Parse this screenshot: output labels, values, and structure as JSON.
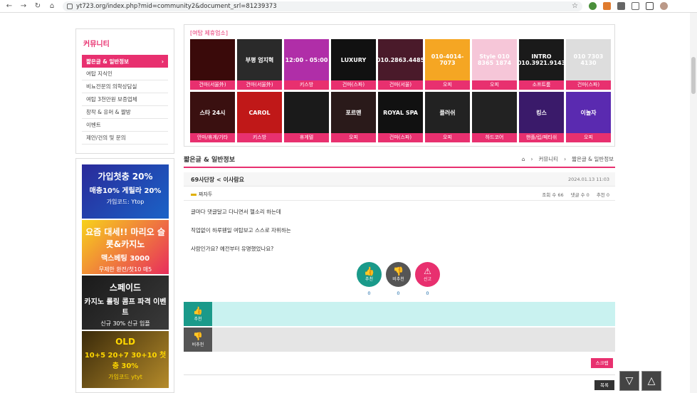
{
  "browser": {
    "url": "yt723.org/index.php?mid=community2&document_srl=81239373"
  },
  "sidebar": {
    "title": "커뮤니티",
    "items": [
      {
        "label": "짧은글 & 일반정보"
      },
      {
        "label": "여탑 지식인"
      },
      {
        "label": "비뇨전문의 의학상담실"
      },
      {
        "label": "여탑 3천만원 보증업체"
      },
      {
        "label": "창작 & 유머 & 짤방"
      },
      {
        "label": "이벤트"
      },
      {
        "label": "제안/건의 및 문의"
      }
    ]
  },
  "banners": [
    {
      "l1": "가입첫충 20%",
      "l2": "매충10% 게릴라 20%",
      "l3": "가입코드: Ytop"
    },
    {
      "l1": "요즘 대세!! 마리오 슬롯&카지노",
      "l2": "맥스베팅 3000",
      "l3": "무제한 환전/첫10 매5"
    },
    {
      "l1": "스페이드",
      "l2": "카지노 롤링 콤프 파격 이벤트",
      "l3": "신규 30%  신규 입플"
    },
    {
      "l1": "OLD",
      "l2": "10+5 20+7 30+10 첫충 30%",
      "l3": "가입코드 ytyt"
    }
  ],
  "affiliates": {
    "title": "[여탑 제휴업소]",
    "tiles": [
      {
        "text": "",
        "cap": "건마(서울外)",
        "color": "#3a0a0a"
      },
      {
        "text": "부평 엄지혁",
        "cap": "건마(서울外)",
        "color": "#2a2a2a"
      },
      {
        "text": "12:00 - 05:00",
        "cap": "키스방",
        "color": "#b02ea8"
      },
      {
        "text": "LUXURY",
        "cap": "건마(스파)",
        "color": "#111"
      },
      {
        "text": "010.2863.4485",
        "cap": "건마(서울)",
        "color": "#4a1a2a"
      },
      {
        "text": "010-4014-7073",
        "cap": "오피",
        "color": "#f5a623"
      },
      {
        "text": "Style 010 8365 1874",
        "cap": "오피",
        "color": "#f6c6d8"
      },
      {
        "text": "INTRO 010.3921.9143",
        "cap": "소프트룸",
        "color": "#1a1a1a"
      },
      {
        "text": "010 7303 4130",
        "cap": "건마(스파)",
        "color": "#ddd"
      },
      {
        "text": "스타 24시",
        "cap": "안마/휴게/기타",
        "color": "#3a1010"
      },
      {
        "text": "CAROL",
        "cap": "키스방",
        "color": "#c01818"
      },
      {
        "text": "",
        "cap": "휴게텔",
        "color": "#1a1a1a"
      },
      {
        "text": "포르맨",
        "cap": "오피",
        "color": "#2a1a1a"
      },
      {
        "text": "ROYAL SPA",
        "cap": "건마(스파)",
        "color": "#111"
      },
      {
        "text": "플러쉬",
        "cap": "오피",
        "color": "#222"
      },
      {
        "text": "",
        "cap": "하드코어",
        "color": "#222"
      },
      {
        "text": "킹스",
        "cap": "핸플/립/페티쉬",
        "color": "#3a1a6a"
      },
      {
        "text": "이놀자",
        "cap": "오피",
        "color": "#5a2ab0"
      }
    ]
  },
  "board": {
    "title": "짧은글 & 일반정보",
    "breadcrumb": [
      "커뮤니티",
      "짧은글 & 일반정보"
    ]
  },
  "post": {
    "title": "69사단장 < 이사람요",
    "date": "2024.01.13 11:03",
    "author": "짜자두",
    "views": "조회 수 66",
    "comments": "댓글 수 0",
    "recommends": "추천 0",
    "lines": [
      "글마다 댓글달고 다니면서 헬소리 하는데",
      "직업없이 하루웬일 여탑보고 스스로 자위하는",
      "사람인가요? 예전부터 유명했었나요?"
    ]
  },
  "votes": {
    "up_label": "추천",
    "down_label": "비추천",
    "report_label": "신고",
    "up_count": "0",
    "down_count": "0",
    "report_count": "0"
  },
  "buttons": {
    "scrap": "스크랩",
    "list": "목록"
  },
  "colors": {
    "accent": "#e8306f",
    "teal": "#1a9a8a"
  }
}
